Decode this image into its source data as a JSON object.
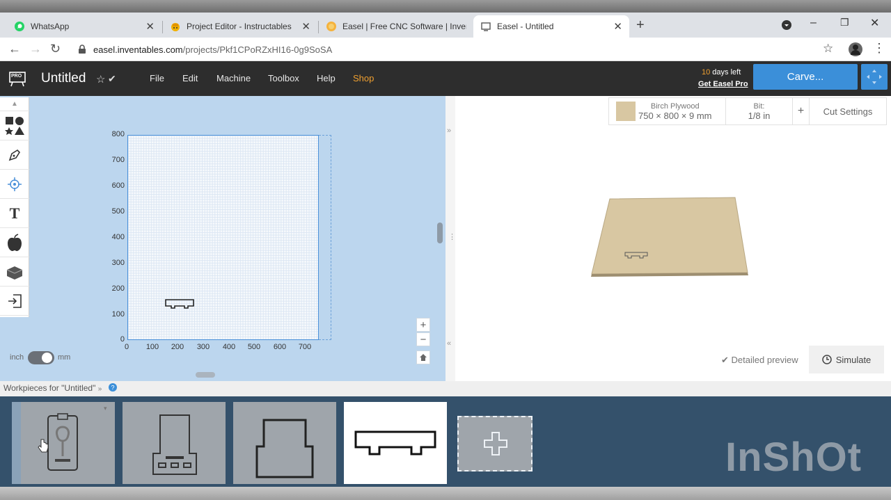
{
  "browser": {
    "tabs": [
      {
        "title": "WhatsApp",
        "icon": "whatsapp-icon",
        "active": false
      },
      {
        "title": "Project Editor - Instructables",
        "icon": "instructables-icon",
        "active": false
      },
      {
        "title": "Easel | Free CNC Software | Inven",
        "icon": "easel-icon",
        "active": false
      },
      {
        "title": "Easel - Untitled",
        "icon": "document-icon",
        "active": true
      }
    ],
    "new_tab": "+",
    "url_host": "easel.inventables.com",
    "url_path": "/projects/Pkf1CPoRZxHI16-0g9SoSA"
  },
  "app": {
    "logo_badge": "PRO",
    "project_title": "Untitled",
    "menu": [
      "File",
      "Edit",
      "Machine",
      "Toolbox",
      "Help",
      "Shop"
    ],
    "shop_color": "#f0a030",
    "days_left_count": "10",
    "days_left_text": " days left",
    "get_pro": "Get Easel Pro",
    "carve_label": "Carve...",
    "accent": "#3b8fd9"
  },
  "canvas": {
    "y_ticks": [
      "800",
      "700",
      "600",
      "500",
      "400",
      "300",
      "200",
      "100",
      "0"
    ],
    "x_ticks": [
      "0",
      "100",
      "200",
      "300",
      "400",
      "500",
      "600",
      "700"
    ],
    "unit_left": "inch",
    "unit_right": "mm",
    "zoom_in": "+",
    "zoom_out": "−"
  },
  "preview": {
    "material_name": "Birch Plywood",
    "material_dims": "750 × 800 × 9 mm",
    "bit_label": "Bit:",
    "bit_value": "1/8 in",
    "add": "+",
    "cut_settings": "Cut Settings",
    "detailed_preview": "Detailed preview",
    "simulate": "Simulate",
    "material_color": "#d8c7a2"
  },
  "workpieces": {
    "label": "Workpieces for \"Untitled\"",
    "count": 4,
    "watermark": "InShOt"
  }
}
